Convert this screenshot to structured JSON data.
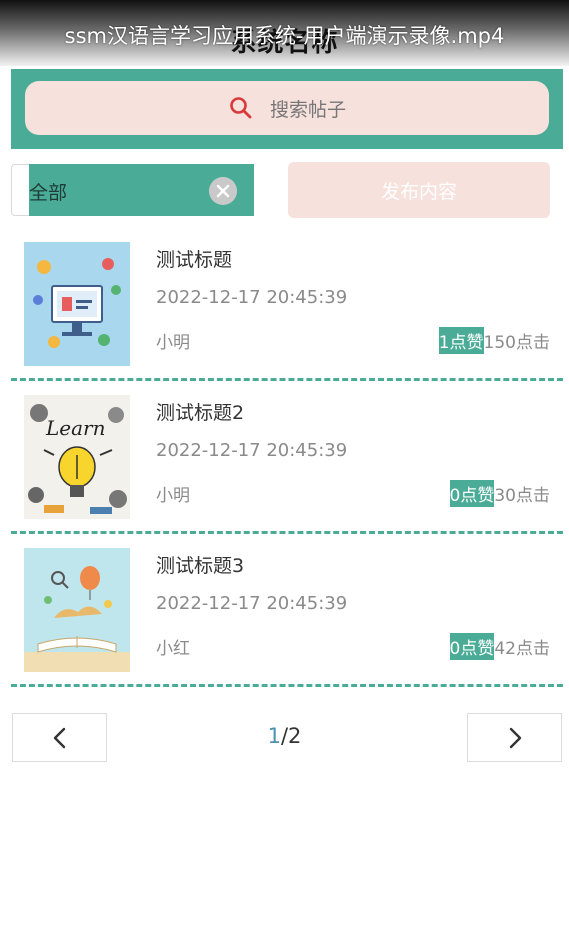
{
  "header": {
    "page_title": "系统名称",
    "video_caption": "ssm汉语言学习应用系统-用户端演示录像.mp4"
  },
  "search": {
    "placeholder": "搜索帖子",
    "icon": "search-icon"
  },
  "filter": {
    "category_value": "全部",
    "clear_icon": "close-circle-icon"
  },
  "actions": {
    "publish_label": "发布内容"
  },
  "posts": [
    {
      "title": "测试标题",
      "time": "2022-12-17 20:45:39",
      "author": "小明",
      "likes": "1点赞",
      "clicks": "150点击",
      "image": "computer-illustration"
    },
    {
      "title": "测试标题2",
      "time": "2022-12-17 20:45:39",
      "author": "小明",
      "likes": "0点赞",
      "clicks": "30点击",
      "image": "learn-lightbulb-illustration"
    },
    {
      "title": "测试标题3",
      "time": "2022-12-17 20:45:39",
      "author": "小红",
      "likes": "0点赞",
      "clicks": "42点击",
      "image": "open-book-illustration"
    }
  ],
  "pagination": {
    "current": "1",
    "separator": "/",
    "total": "2",
    "prev_icon": "chevron-left-icon",
    "next_icon": "chevron-right-icon"
  },
  "colors": {
    "accent": "#4aac96",
    "soft_pink": "#f7e1dc",
    "muted_text": "#8a8a8a",
    "page_link": "#4a90b0"
  }
}
